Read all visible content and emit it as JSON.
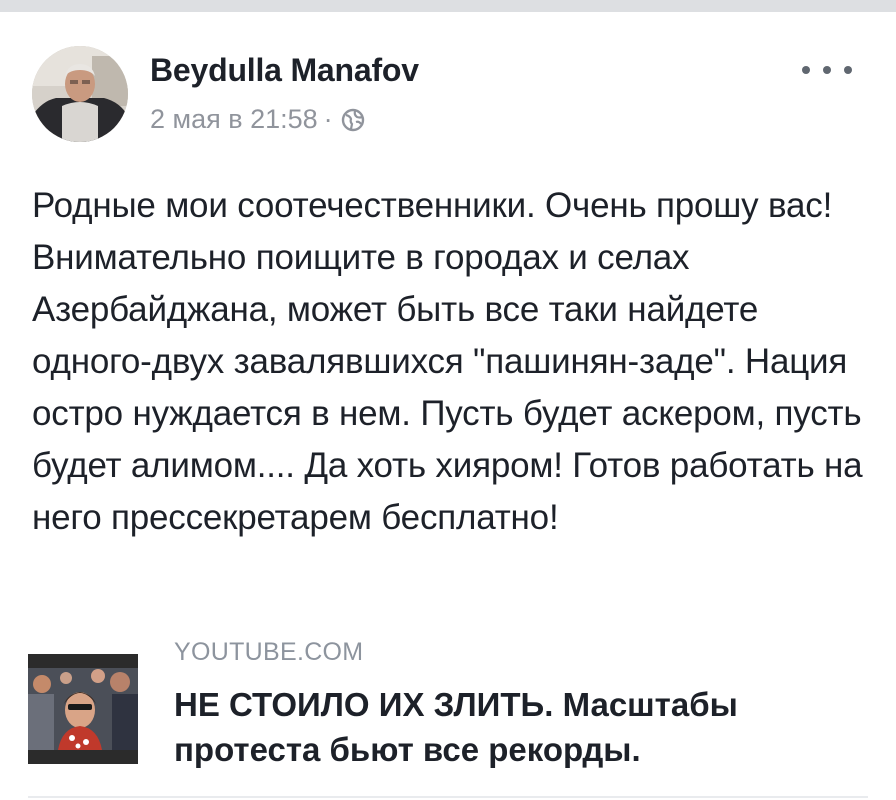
{
  "post": {
    "author": "Beydulla Manafov",
    "timestamp": "2 мая в 21:58",
    "separator": "·",
    "privacy_icon": "globe-icon",
    "menu_icon": "more-options-icon",
    "text": "Родные мои соотечественники. Очень прошу вас! Внимательно поищите в городах и селах Азербайджана, может быть все таки найдете одного-двух завалявшихся \"пашинян-заде\". Нация остро нуждается в нем. Пусть будет аскером, пусть будет алимом.... Да хоть хияром! Готов работать на него прессекретарем бесплатно!"
  },
  "link_preview": {
    "domain": "YOUTUBE.COM",
    "title": "НЕ СТОИЛО ИХ ЗЛИТЬ. Масштабы протеста бьют все рекорды."
  },
  "colors": {
    "text_primary": "#1d2129",
    "text_secondary": "#90949c",
    "divider": "#e9ebee",
    "page_strip": "#dddfe2"
  }
}
